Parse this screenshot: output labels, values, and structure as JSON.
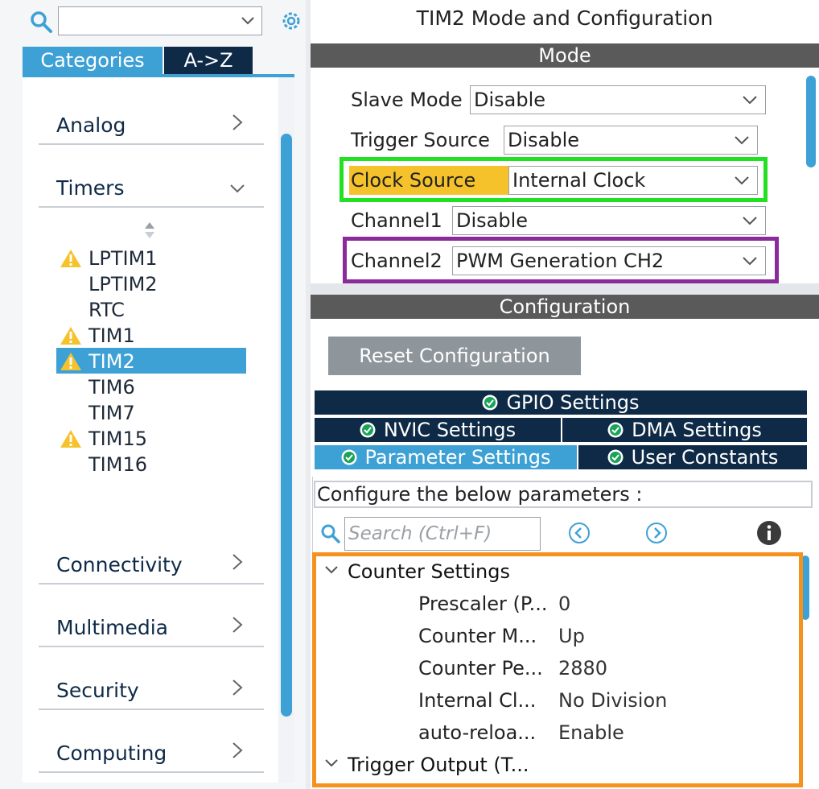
{
  "left": {
    "tabs": {
      "categories": "Categories",
      "az": "A->Z"
    },
    "categories": [
      {
        "label": "Analog"
      },
      {
        "label": "Timers"
      },
      {
        "label": "Connectivity"
      },
      {
        "label": "Multimedia"
      },
      {
        "label": "Security"
      },
      {
        "label": "Computing"
      }
    ],
    "timers": [
      {
        "label": "LPTIM1",
        "warning": true
      },
      {
        "label": "LPTIM2",
        "warning": false
      },
      {
        "label": "RTC",
        "warning": false
      },
      {
        "label": "TIM1",
        "warning": true
      },
      {
        "label": "TIM2",
        "warning": true,
        "selected": true
      },
      {
        "label": "TIM6",
        "warning": false
      },
      {
        "label": "TIM7",
        "warning": false
      },
      {
        "label": "TIM15",
        "warning": true
      },
      {
        "label": "TIM16",
        "warning": false
      }
    ]
  },
  "right": {
    "title": "TIM2 Mode and Configuration",
    "mode_header": "Mode",
    "mode": {
      "slave_mode": {
        "label": "Slave Mode",
        "value": "Disable"
      },
      "trigger_source": {
        "label": "Trigger Source",
        "value": "Disable"
      },
      "clock_source": {
        "label": "Clock Source",
        "value": "Internal Clock"
      },
      "channel1": {
        "label": "Channel1",
        "value": "Disable"
      },
      "channel2": {
        "label": "Channel2",
        "value": "PWM Generation CH2"
      }
    },
    "config_header": "Configuration",
    "reset_button": "Reset Configuration",
    "tabs": {
      "gpio": "GPIO Settings",
      "nvic": "NVIC Settings",
      "dma": "DMA Settings",
      "parameter": "Parameter Settings",
      "user_constants": "User Constants"
    },
    "hint": "Configure the below parameters :",
    "search_placeholder": "Search (Ctrl+F)",
    "groups": {
      "counter": "Counter Settings",
      "trigger": "Trigger Output (T..."
    },
    "params": [
      {
        "name": "Prescaler (P...",
        "value": "0"
      },
      {
        "name": "Counter M...",
        "value": "Up"
      },
      {
        "name": "Counter Pe...",
        "value": "2880"
      },
      {
        "name": "Internal Cl...",
        "value": "No Division"
      },
      {
        "name": "auto-reloa...",
        "value": "Enable"
      }
    ],
    "colors": {
      "accent": "#3ea1d5",
      "navy": "#0e2a47",
      "highlight_green": "#22e022",
      "highlight_purple": "#8a2a9b",
      "highlight_orange": "#f5921e",
      "clock_label_bg": "#f6c22b"
    }
  }
}
